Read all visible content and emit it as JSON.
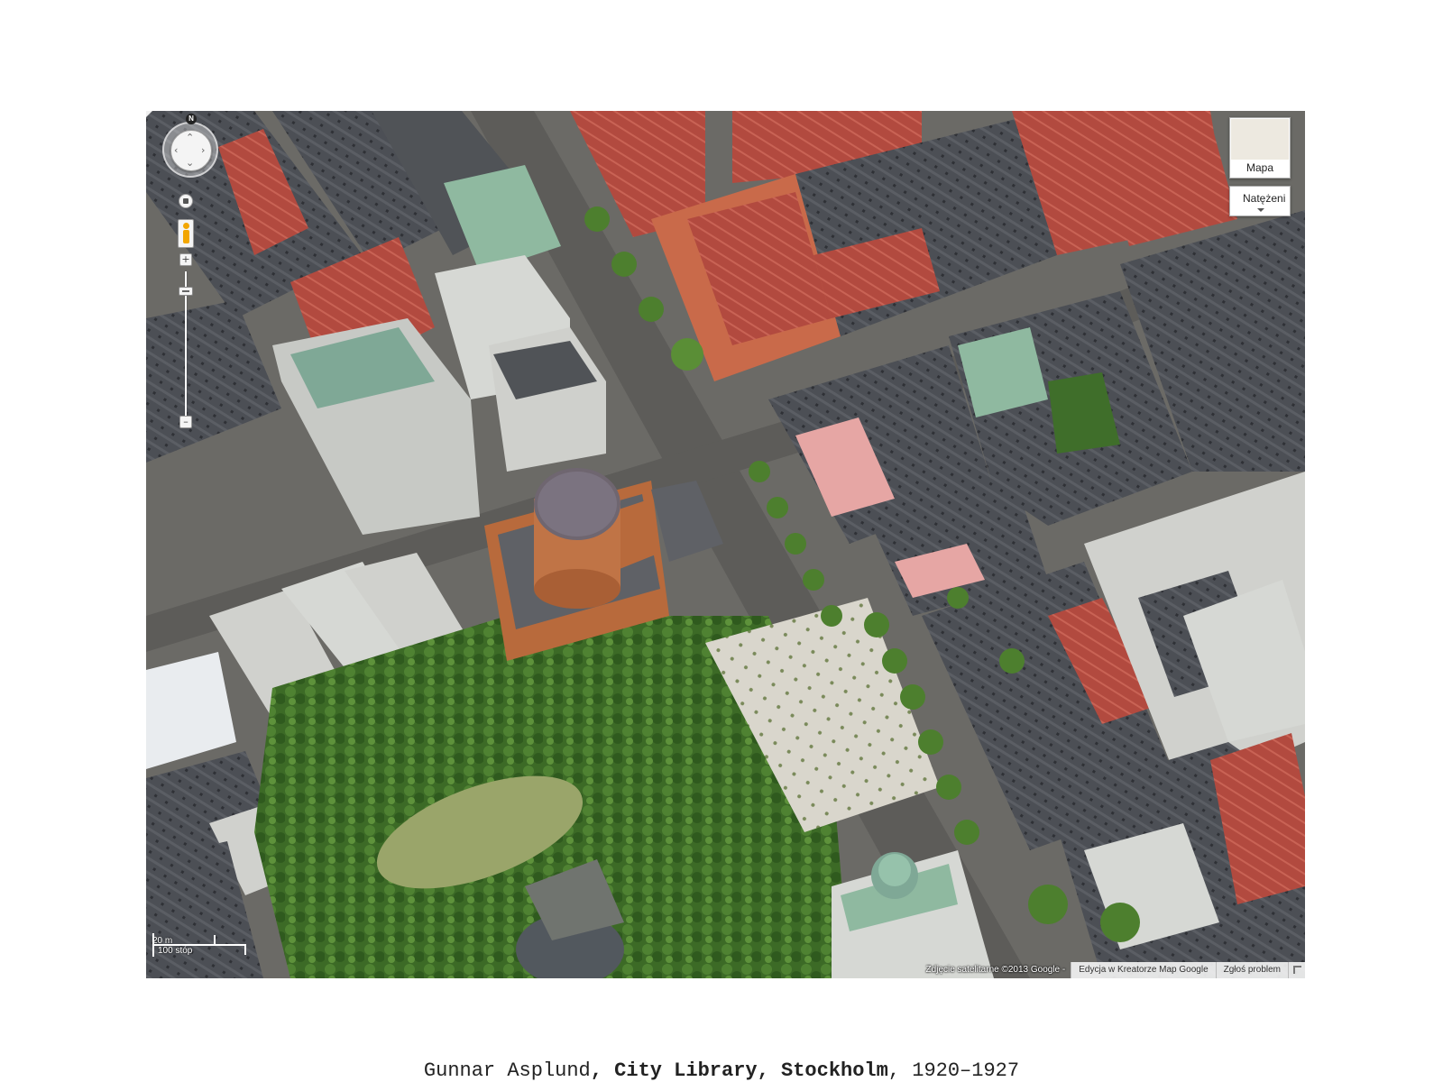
{
  "map": {
    "compass_label": "N",
    "map_type_button": "Mapa",
    "traffic_button": "Natężeni",
    "scale": {
      "metric": "20 m",
      "imperial": "100 stóp"
    },
    "attribution": {
      "imagery": "Zdjęcie satelitarne ©2013 Google -",
      "edit_link": "Edycja w Kreatorze Map Google",
      "report_link": "Zgłoś problem"
    },
    "icons": [
      "compass-icon",
      "pan-control",
      "rotate-icon",
      "pegman-icon",
      "zoom-in-icon",
      "zoom-out-icon",
      "fullscreen-corner-icon"
    ],
    "colors": {
      "roof_red": "#b84a3e",
      "roof_grey": "#4a4d52",
      "roof_copper": "#8fb9a0",
      "library_brick": "#b86a3c",
      "library_rotunda_roof": "#6f6670",
      "park_green": "#3f6e2a",
      "street": "#6b6a66"
    }
  },
  "caption": {
    "architect": "Gunnar Asplund",
    "sep1": ", ",
    "building": "City Library",
    "sep2": ", ",
    "city": "Stockholm",
    "sep3": ", ",
    "years": "1920–1927"
  }
}
